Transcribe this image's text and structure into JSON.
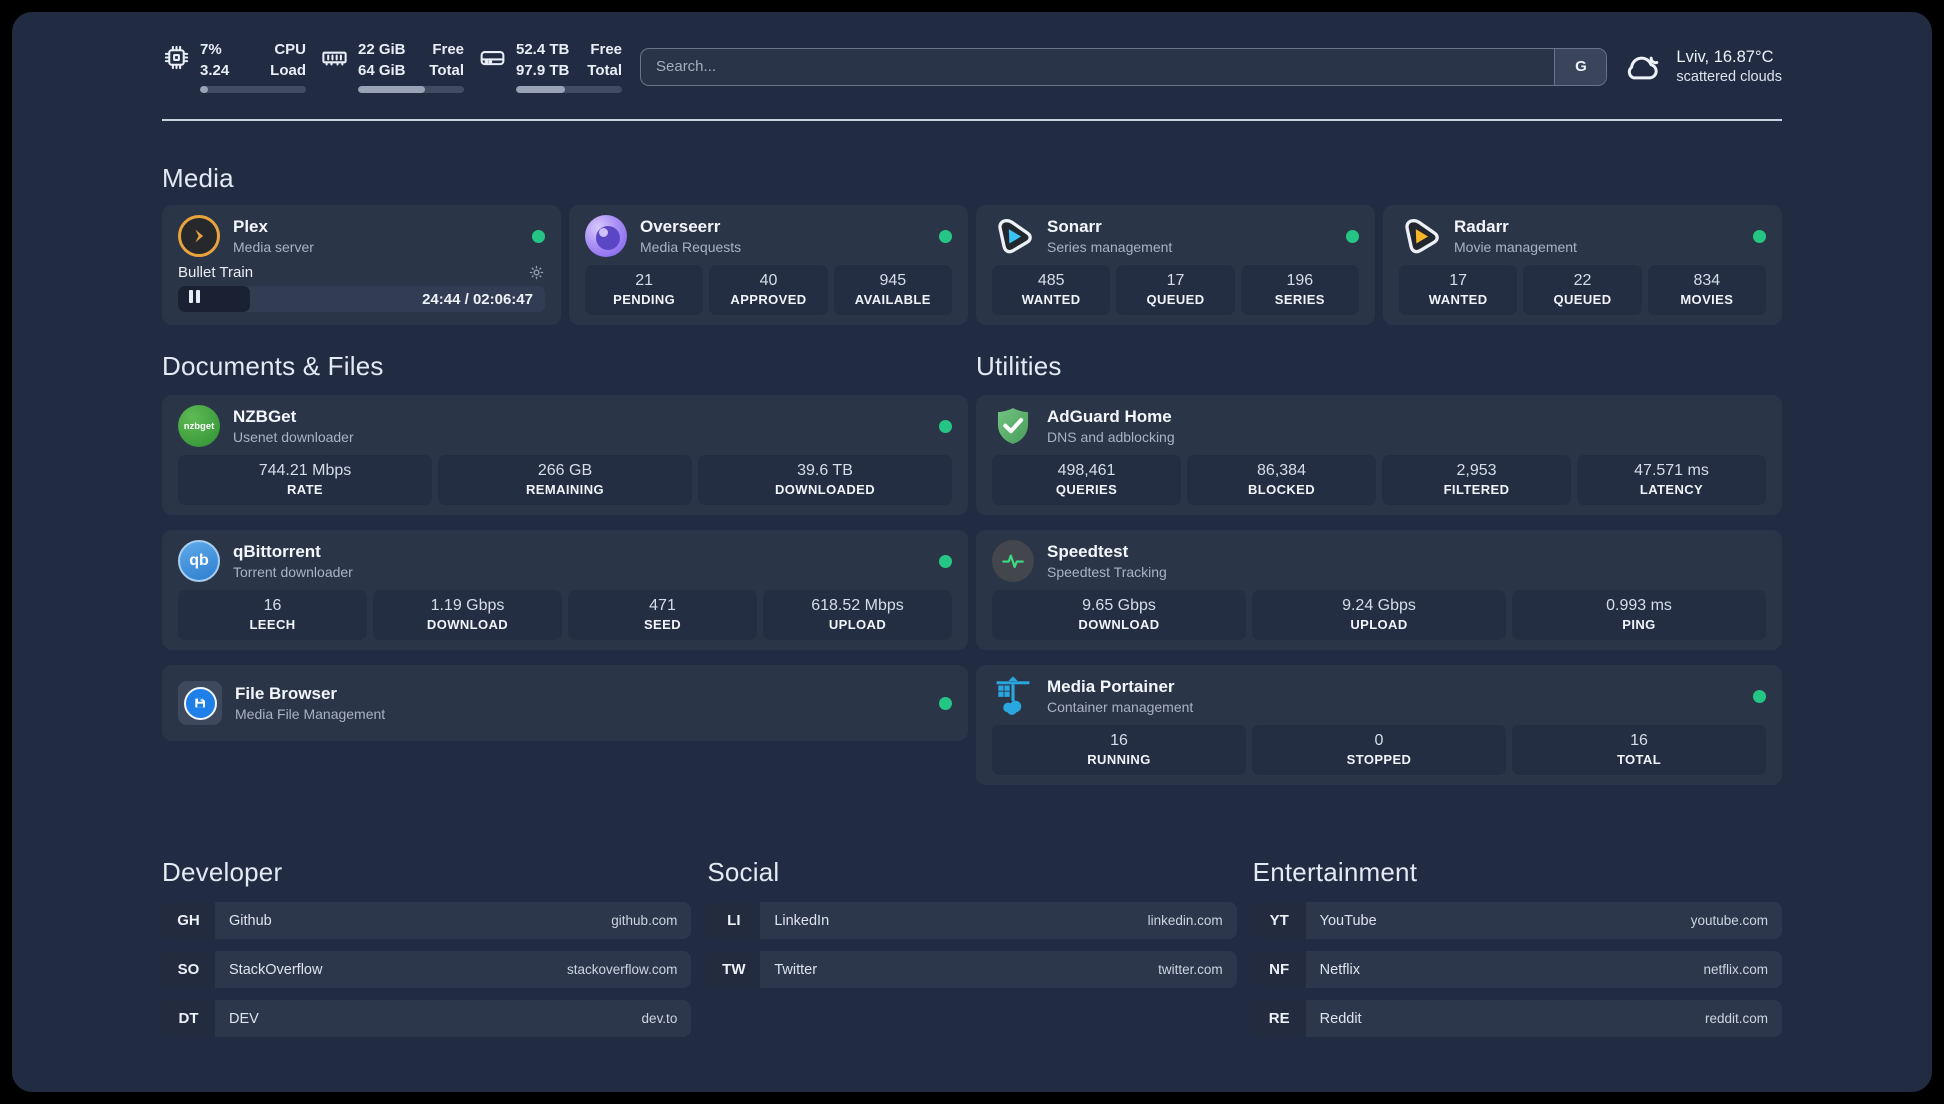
{
  "topbar": {
    "metrics": [
      {
        "name": "cpu",
        "values": [
          "7%",
          "3.24"
        ],
        "labels": [
          "CPU",
          "Load"
        ],
        "progress_pct": 8
      },
      {
        "name": "memory",
        "values": [
          "22 GiB",
          "64 GiB"
        ],
        "labels": [
          "Free",
          "Total"
        ],
        "progress_pct": 63
      },
      {
        "name": "storage",
        "values": [
          "52.4 TB",
          "97.9 TB"
        ],
        "labels": [
          "Free",
          "Total"
        ],
        "progress_pct": 46
      }
    ],
    "search": {
      "placeholder": "Search...",
      "engine_button": "G"
    },
    "weather": {
      "location": "Lviv, 16.87°C",
      "condition": "scattered clouds"
    }
  },
  "media": {
    "heading": "Media",
    "plex": {
      "title": "Plex",
      "subtitle": "Media server",
      "now_playing": {
        "title": "Bullet Train",
        "time": "24:44 / 02:06:47",
        "progress_pct": 19.5
      }
    },
    "overseerr": {
      "title": "Overseerr",
      "subtitle": "Media Requests",
      "stats": [
        {
          "value": "21",
          "label": "PENDING"
        },
        {
          "value": "40",
          "label": "APPROVED"
        },
        {
          "value": "945",
          "label": "AVAILABLE"
        }
      ]
    },
    "sonarr": {
      "title": "Sonarr",
      "subtitle": "Series management",
      "stats": [
        {
          "value": "485",
          "label": "WANTED"
        },
        {
          "value": "17",
          "label": "QUEUED"
        },
        {
          "value": "196",
          "label": "SERIES"
        }
      ]
    },
    "radarr": {
      "title": "Radarr",
      "subtitle": "Movie management",
      "stats": [
        {
          "value": "17",
          "label": "WANTED"
        },
        {
          "value": "22",
          "label": "QUEUED"
        },
        {
          "value": "834",
          "label": "MOVIES"
        }
      ]
    }
  },
  "documents": {
    "heading": "Documents & Files",
    "nzbget": {
      "title": "NZBGet",
      "subtitle": "Usenet downloader",
      "icon_text": "nzbget",
      "stats": [
        {
          "value": "744.21 Mbps",
          "label": "RATE"
        },
        {
          "value": "266 GB",
          "label": "REMAINING"
        },
        {
          "value": "39.6 TB",
          "label": "DOWNLOADED"
        }
      ]
    },
    "qbittorrent": {
      "title": "qBittorrent",
      "subtitle": "Torrent downloader",
      "icon_text": "qb",
      "stats": [
        {
          "value": "16",
          "label": "LEECH"
        },
        {
          "value": "1.19 Gbps",
          "label": "DOWNLOAD"
        },
        {
          "value": "471",
          "label": "SEED"
        },
        {
          "value": "618.52 Mbps",
          "label": "UPLOAD"
        }
      ]
    },
    "filebrowser": {
      "title": "File Browser",
      "subtitle": "Media File Management"
    }
  },
  "utilities": {
    "heading": "Utilities",
    "adguard": {
      "title": "AdGuard Home",
      "subtitle": "DNS and adblocking",
      "stats": [
        {
          "value": "498,461",
          "label": "QUERIES"
        },
        {
          "value": "86,384",
          "label": "BLOCKED"
        },
        {
          "value": "2,953",
          "label": "FILTERED"
        },
        {
          "value": "47.571 ms",
          "label": "LATENCY"
        }
      ]
    },
    "speedtest": {
      "title": "Speedtest",
      "subtitle": "Speedtest Tracking",
      "stats": [
        {
          "value": "9.65 Gbps",
          "label": "DOWNLOAD"
        },
        {
          "value": "9.24 Gbps",
          "label": "UPLOAD"
        },
        {
          "value": "0.993 ms",
          "label": "PING"
        }
      ]
    },
    "portainer": {
      "title": "Media Portainer",
      "subtitle": "Container management",
      "stats": [
        {
          "value": "16",
          "label": "RUNNING"
        },
        {
          "value": "0",
          "label": "STOPPED"
        },
        {
          "value": "16",
          "label": "TOTAL"
        }
      ]
    }
  },
  "links": {
    "developer": {
      "heading": "Developer",
      "items": [
        {
          "tag": "GH",
          "name": "Github",
          "url": "github.com"
        },
        {
          "tag": "SO",
          "name": "StackOverflow",
          "url": "stackoverflow.com"
        },
        {
          "tag": "DT",
          "name": "DEV",
          "url": "dev.to"
        }
      ]
    },
    "social": {
      "heading": "Social",
      "items": [
        {
          "tag": "LI",
          "name": "LinkedIn",
          "url": "linkedin.com"
        },
        {
          "tag": "TW",
          "name": "Twitter",
          "url": "twitter.com"
        }
      ]
    },
    "entertainment": {
      "heading": "Entertainment",
      "items": [
        {
          "tag": "YT",
          "name": "YouTube",
          "url": "youtube.com"
        },
        {
          "tag": "NF",
          "name": "Netflix",
          "url": "netflix.com"
        },
        {
          "tag": "RE",
          "name": "Reddit",
          "url": "reddit.com"
        }
      ]
    }
  },
  "colors": {
    "status_online": "#25c685",
    "sonarr_accent": "#3ac3f2",
    "radarr_accent": "#f7b52a",
    "adguard_green": "#5cb56e",
    "portainer_blue": "#2ba7df",
    "plex_orange": "#e8a33d"
  }
}
